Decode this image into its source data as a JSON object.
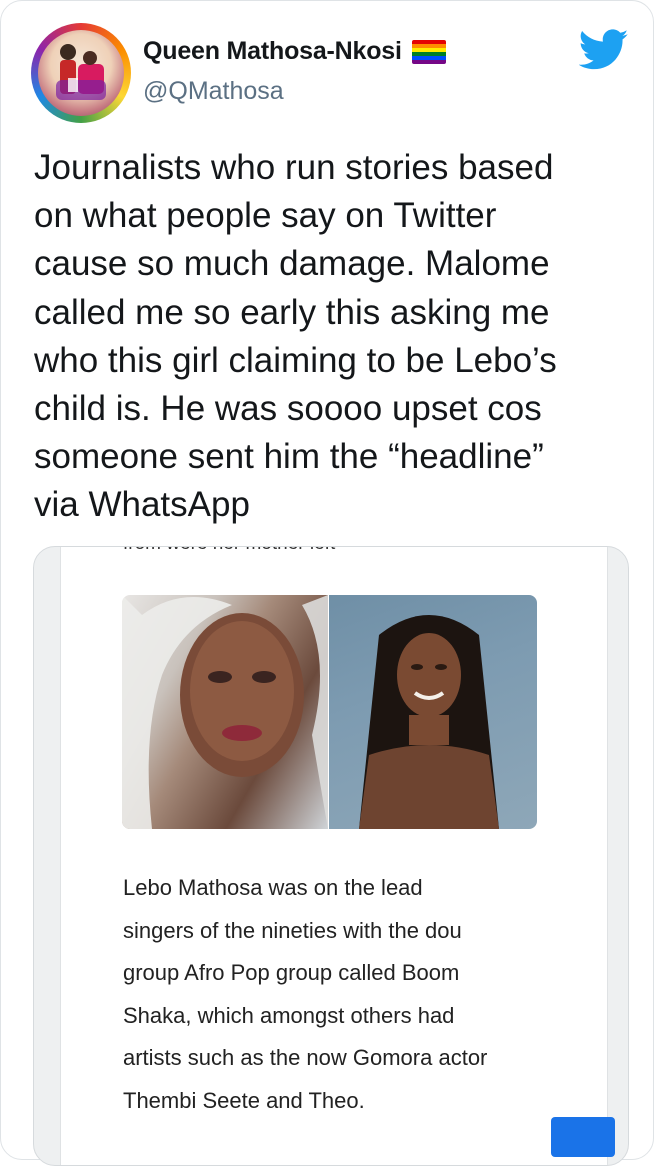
{
  "author": {
    "display_name": "Queen Mathosa-Nkosi",
    "handle": "@QMathosa",
    "flag_icon": "rainbow-pride-flag-icon",
    "flag_colors": [
      "#e40303",
      "#ff8c00",
      "#ffed00",
      "#008026",
      "#004dff",
      "#750787"
    ]
  },
  "platform": {
    "logo_icon": "twitter-bird-icon",
    "logo_color": "#1da1f2"
  },
  "tweet": {
    "text": "Journalists who run stories based\non what people say on Twitter\ncause so much damage. Malome\ncalled me so early this asking me\nwho this girl claiming to be Lebo’s\nchild is. He was soooo upset cos\nsomeone sent him the “headline”\nvia WhatsApp"
  },
  "attached_screenshot": {
    "cut_off_line": "from were her mother left",
    "article_text": "Lebo Mathosa was on the lead\nsingers of the nineties with the dou\ngroup Afro Pop group called Boom\nShaka, which amongst others had\nartists such as the now Gomora actor\nThembi Seete and Theo.",
    "button_color": "#1a73e8"
  }
}
